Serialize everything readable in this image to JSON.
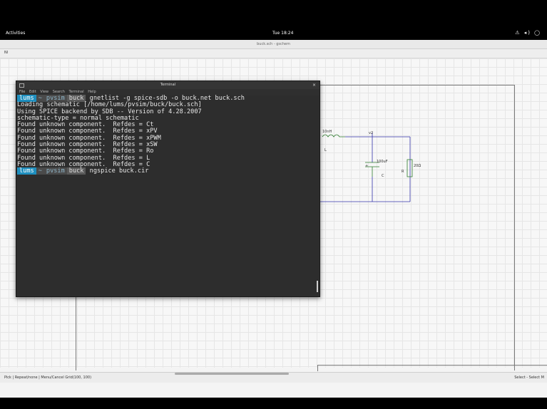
{
  "topbar": {
    "activities": "Activities",
    "clock": "Tue 18:24",
    "tray": "⚠ ◂) ◯"
  },
  "app": {
    "title": "buck.sch - gschem",
    "tab": "NI"
  },
  "statusbar": {
    "left": "Pick | Repeat/none | Menu/Cancel    Grid(100, 100)",
    "right": "Select - Select M"
  },
  "terminal": {
    "title": "Terminal",
    "close": "×",
    "menu": [
      "File",
      "Edit",
      "View",
      "Search",
      "Terminal",
      "Help"
    ],
    "prompt_user": "lums",
    "prompt_path": "~",
    "prompt_dir1": "pvsim",
    "prompt_dir2": "buck",
    "cmd1": " gnetlist -g spice-sdb -o buck.net buck.sch",
    "lines": [
      "Loading schematic [/home/lums/pvsim/buck/buck.sch]",
      "Using SPICE backend by SDB -- Version of 4.28.2007",
      "schematic-type = normal schematic",
      "Found unknown component.  Refdes = Ct",
      "Found unknown component.  Refdes = xPV",
      "Found unknown component.  Refdes = xPWM",
      "Found unknown component.  Refdes = xSW",
      "Found unknown component.  Refdes = Ro",
      "Found unknown component.  Refdes = L",
      "Found unknown component.  Refdes = C"
    ],
    "cmd2": " ngspice buck.cir"
  },
  "schematic": {
    "inductor_value": "10nH",
    "inductor_ref": "L",
    "node": "v2",
    "cap_value": "100uF",
    "cap_ref": "C",
    "res_value": "20Ω",
    "res_ref": "R",
    "plus": "+"
  }
}
